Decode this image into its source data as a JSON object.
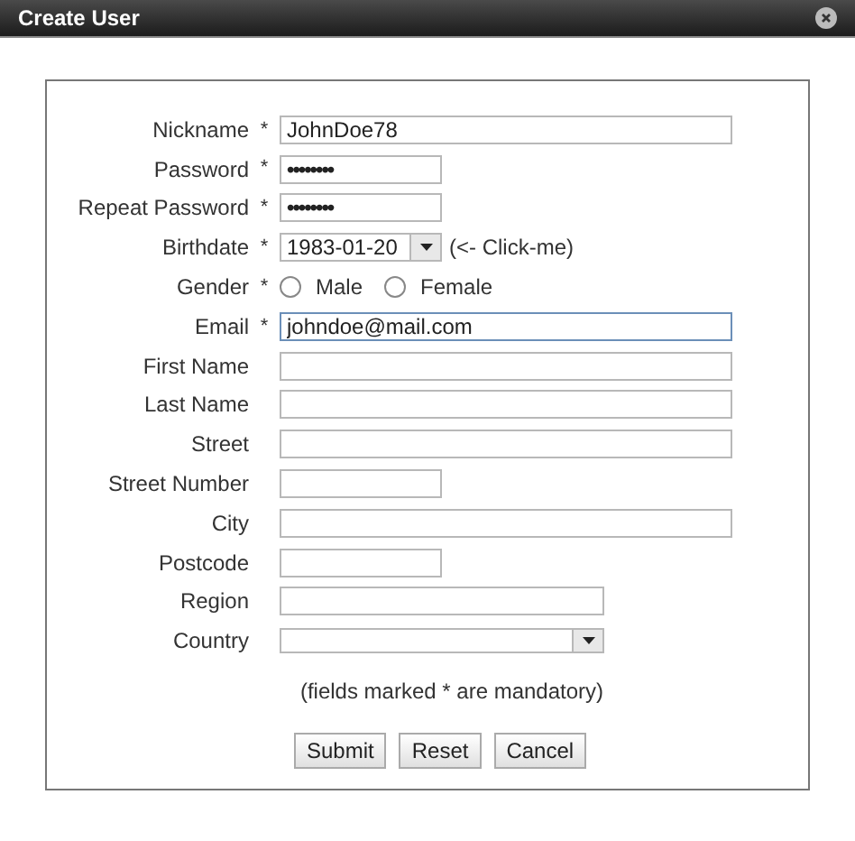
{
  "window": {
    "title": "Create User"
  },
  "fields": [
    {
      "kind": "wide",
      "label": "Nickname",
      "required": true,
      "value": "JohnDoe78",
      "focused": false
    },
    {
      "kind": "password",
      "label": "Password",
      "required": true,
      "value": "••••••••",
      "focused": false
    },
    {
      "kind": "password",
      "label": "Repeat Password",
      "required": true,
      "value": "••••••••",
      "focused": false
    },
    {
      "kind": "date",
      "label": "Birthdate",
      "required": true,
      "value": "1983-01-20",
      "hint": "(<- Click-me)",
      "focused": false
    },
    {
      "kind": "radio",
      "label": "Gender",
      "required": true,
      "options": [
        {
          "label": "Male",
          "selected": false
        },
        {
          "label": "Female",
          "selected": false
        }
      ]
    },
    {
      "kind": "wide",
      "label": "Email",
      "required": true,
      "value": "johndoe@mail.com",
      "focused": true
    },
    {
      "kind": "wide",
      "label": "First Name",
      "required": false,
      "focused": false
    },
    {
      "kind": "wide",
      "label": "Last Name",
      "required": false,
      "focused": false
    },
    {
      "kind": "wide",
      "label": "Street",
      "required": false,
      "focused": false
    },
    {
      "kind": "narrow",
      "label": "Street Number",
      "required": false,
      "focused": false
    },
    {
      "kind": "wide",
      "label": "City",
      "required": false,
      "focused": false
    },
    {
      "kind": "narrow",
      "label": "Postcode",
      "required": false,
      "focused": false
    },
    {
      "kind": "medium",
      "label": "Region",
      "required": false,
      "focused": false
    },
    {
      "kind": "select",
      "label": "Country",
      "required": false,
      "focused": false
    }
  ],
  "required_marker": "*",
  "note": "(fields marked * are mandatory)",
  "buttons": [
    "Submit",
    "Reset",
    "Cancel"
  ]
}
